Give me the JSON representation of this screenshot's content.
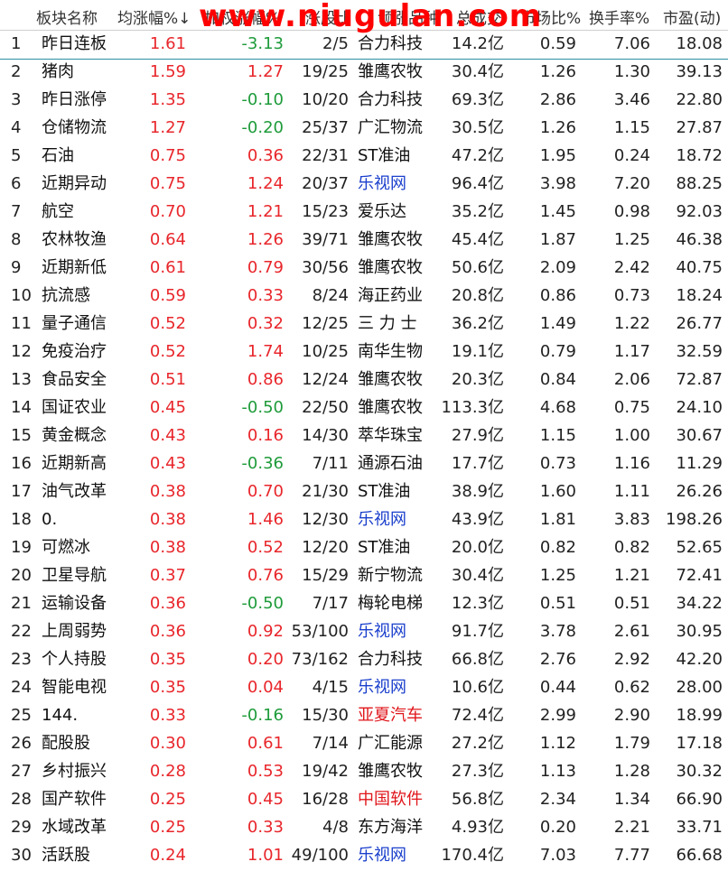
{
  "header": {
    "col_no": "",
    "col_name": "板块名称",
    "col_avg": "均涨幅%",
    "sort_indicator": "↓",
    "col_weighted": "加权涨幅%",
    "col_updown": "涨股比",
    "col_leader": "领涨品种",
    "col_amount": "总成交",
    "col_market": "市场比%",
    "col_turnover": "换手率%",
    "col_pe": "市盈(动)",
    "watermark": "www.niugulan.com"
  },
  "colors": {
    "up": "#e8262b",
    "down": "#1e9b3a",
    "link": "#1a3fcc"
  },
  "rows": [
    {
      "no": "1",
      "name": "昨日连板",
      "avg": "1.61",
      "wt": "-3.13",
      "ud": "2/5",
      "lead": "合力科技",
      "amt": "14.2亿",
      "mkt": "0.59",
      "turn": "7.06",
      "pe": "18.08",
      "lead_style": "normal",
      "wt_dir": "down"
    },
    {
      "no": "2",
      "name": "猪肉",
      "avg": "1.59",
      "wt": "1.27",
      "ud": "19/25",
      "lead": "雏鹰农牧",
      "amt": "30.4亿",
      "mkt": "1.26",
      "turn": "1.30",
      "pe": "39.13",
      "lead_style": "normal",
      "wt_dir": "up"
    },
    {
      "no": "3",
      "name": "昨日涨停",
      "avg": "1.35",
      "wt": "-0.10",
      "ud": "10/20",
      "lead": "合力科技",
      "amt": "69.3亿",
      "mkt": "2.86",
      "turn": "3.46",
      "pe": "22.80",
      "lead_style": "normal",
      "wt_dir": "down"
    },
    {
      "no": "4",
      "name": "仓储物流",
      "avg": "1.27",
      "wt": "-0.20",
      "ud": "25/37",
      "lead": "广汇物流",
      "amt": "30.5亿",
      "mkt": "1.26",
      "turn": "1.15",
      "pe": "27.87",
      "lead_style": "normal",
      "wt_dir": "down"
    },
    {
      "no": "5",
      "name": "石油",
      "avg": "0.75",
      "wt": "0.36",
      "ud": "22/31",
      "lead": "ST准油",
      "amt": "47.2亿",
      "mkt": "1.95",
      "turn": "0.24",
      "pe": "18.72",
      "lead_style": "normal",
      "wt_dir": "up"
    },
    {
      "no": "6",
      "name": "近期异动",
      "avg": "0.75",
      "wt": "1.24",
      "ud": "20/37",
      "lead": "乐视网",
      "amt": "96.4亿",
      "mkt": "3.98",
      "turn": "7.20",
      "pe": "88.25",
      "lead_style": "blue",
      "wt_dir": "up"
    },
    {
      "no": "7",
      "name": "航空",
      "avg": "0.70",
      "wt": "1.21",
      "ud": "15/23",
      "lead": "爱乐达",
      "amt": "35.2亿",
      "mkt": "1.45",
      "turn": "0.98",
      "pe": "92.03",
      "lead_style": "normal",
      "wt_dir": "up"
    },
    {
      "no": "8",
      "name": "农林牧渔",
      "avg": "0.64",
      "wt": "1.26",
      "ud": "39/71",
      "lead": "雏鹰农牧",
      "amt": "45.4亿",
      "mkt": "1.87",
      "turn": "1.25",
      "pe": "46.38",
      "lead_style": "normal",
      "wt_dir": "up"
    },
    {
      "no": "9",
      "name": "近期新低",
      "avg": "0.61",
      "wt": "0.79",
      "ud": "30/56",
      "lead": "雏鹰农牧",
      "amt": "50.6亿",
      "mkt": "2.09",
      "turn": "2.42",
      "pe": "40.75",
      "lead_style": "normal",
      "wt_dir": "up"
    },
    {
      "no": "10",
      "name": "抗流感",
      "avg": "0.59",
      "wt": "0.33",
      "ud": "8/24",
      "lead": "海正药业",
      "amt": "20.8亿",
      "mkt": "0.86",
      "turn": "0.73",
      "pe": "18.24",
      "lead_style": "normal",
      "wt_dir": "up"
    },
    {
      "no": "11",
      "name": "量子通信",
      "avg": "0.52",
      "wt": "0.32",
      "ud": "12/25",
      "lead": "三 力 士",
      "amt": "36.2亿",
      "mkt": "1.49",
      "turn": "1.22",
      "pe": "26.77",
      "lead_style": "normal",
      "wt_dir": "up"
    },
    {
      "no": "12",
      "name": "免疫治疗",
      "avg": "0.52",
      "wt": "1.74",
      "ud": "10/25",
      "lead": "南华生物",
      "amt": "19.1亿",
      "mkt": "0.79",
      "turn": "1.17",
      "pe": "32.59",
      "lead_style": "normal",
      "wt_dir": "up"
    },
    {
      "no": "13",
      "name": "食品安全",
      "avg": "0.51",
      "wt": "0.86",
      "ud": "12/24",
      "lead": "雏鹰农牧",
      "amt": "20.3亿",
      "mkt": "0.84",
      "turn": "2.06",
      "pe": "72.87",
      "lead_style": "normal",
      "wt_dir": "up"
    },
    {
      "no": "14",
      "name": "国证农业",
      "avg": "0.45",
      "wt": "-0.50",
      "ud": "22/50",
      "lead": "雏鹰农牧",
      "amt": "113.3亿",
      "mkt": "4.68",
      "turn": "0.75",
      "pe": "24.10",
      "lead_style": "normal",
      "wt_dir": "down"
    },
    {
      "no": "15",
      "name": "黄金概念",
      "avg": "0.43",
      "wt": "0.16",
      "ud": "14/30",
      "lead": "萃华珠宝",
      "amt": "27.9亿",
      "mkt": "1.15",
      "turn": "1.00",
      "pe": "30.67",
      "lead_style": "normal",
      "wt_dir": "up"
    },
    {
      "no": "16",
      "name": "近期新高",
      "avg": "0.43",
      "wt": "-0.36",
      "ud": "7/11",
      "lead": "通源石油",
      "amt": "17.7亿",
      "mkt": "0.73",
      "turn": "1.16",
      "pe": "11.29",
      "lead_style": "normal",
      "wt_dir": "down"
    },
    {
      "no": "17",
      "name": "油气改革",
      "avg": "0.38",
      "wt": "0.70",
      "ud": "21/30",
      "lead": "ST准油",
      "amt": "38.9亿",
      "mkt": "1.60",
      "turn": "1.11",
      "pe": "26.26",
      "lead_style": "normal",
      "wt_dir": "up"
    },
    {
      "no": "18",
      "name": "0.",
      "avg": "0.38",
      "wt": "1.46",
      "ud": "12/30",
      "lead": "乐视网",
      "amt": "43.9亿",
      "mkt": "1.81",
      "turn": "3.83",
      "pe": "198.26",
      "lead_style": "blue",
      "wt_dir": "up"
    },
    {
      "no": "19",
      "name": "可燃冰",
      "avg": "0.38",
      "wt": "0.52",
      "ud": "12/20",
      "lead": "ST准油",
      "amt": "20.0亿",
      "mkt": "0.82",
      "turn": "0.82",
      "pe": "52.65",
      "lead_style": "normal",
      "wt_dir": "up"
    },
    {
      "no": "20",
      "name": "卫星导航",
      "avg": "0.37",
      "wt": "0.76",
      "ud": "15/29",
      "lead": "新宁物流",
      "amt": "30.4亿",
      "mkt": "1.25",
      "turn": "1.21",
      "pe": "72.41",
      "lead_style": "normal",
      "wt_dir": "up"
    },
    {
      "no": "21",
      "name": "运输设备",
      "avg": "0.36",
      "wt": "-0.50",
      "ud": "7/17",
      "lead": "梅轮电梯",
      "amt": "12.3亿",
      "mkt": "0.51",
      "turn": "0.51",
      "pe": "34.22",
      "lead_style": "normal",
      "wt_dir": "down"
    },
    {
      "no": "22",
      "name": "上周弱势",
      "avg": "0.36",
      "wt": "0.92",
      "ud": "53/100",
      "lead": "乐视网",
      "amt": "91.7亿",
      "mkt": "3.78",
      "turn": "2.61",
      "pe": "30.95",
      "lead_style": "blue",
      "wt_dir": "up"
    },
    {
      "no": "23",
      "name": "个人持股",
      "avg": "0.35",
      "wt": "0.20",
      "ud": "73/162",
      "lead": "合力科技",
      "amt": "66.8亿",
      "mkt": "2.76",
      "turn": "2.92",
      "pe": "42.20",
      "lead_style": "normal",
      "wt_dir": "up"
    },
    {
      "no": "24",
      "name": "智能电视",
      "avg": "0.35",
      "wt": "0.04",
      "ud": "4/15",
      "lead": "乐视网",
      "amt": "10.6亿",
      "mkt": "0.44",
      "turn": "0.62",
      "pe": "28.00",
      "lead_style": "blue",
      "wt_dir": "up"
    },
    {
      "no": "25",
      "name": "144.",
      "avg": "0.33",
      "wt": "-0.16",
      "ud": "15/30",
      "lead": "亚夏汽车",
      "amt": "72.4亿",
      "mkt": "2.99",
      "turn": "2.90",
      "pe": "18.99",
      "lead_style": "red",
      "wt_dir": "down"
    },
    {
      "no": "26",
      "name": "配股股",
      "avg": "0.30",
      "wt": "0.61",
      "ud": "7/14",
      "lead": "广汇能源",
      "amt": "27.2亿",
      "mkt": "1.12",
      "turn": "1.79",
      "pe": "17.18",
      "lead_style": "normal",
      "wt_dir": "up"
    },
    {
      "no": "27",
      "name": "乡村振兴",
      "avg": "0.28",
      "wt": "0.53",
      "ud": "19/42",
      "lead": "雏鹰农牧",
      "amt": "27.3亿",
      "mkt": "1.13",
      "turn": "1.28",
      "pe": "30.32",
      "lead_style": "normal",
      "wt_dir": "up"
    },
    {
      "no": "28",
      "name": "国产软件",
      "avg": "0.25",
      "wt": "0.45",
      "ud": "16/28",
      "lead": "中国软件",
      "amt": "56.8亿",
      "mkt": "2.34",
      "turn": "1.34",
      "pe": "66.90",
      "lead_style": "red",
      "wt_dir": "up"
    },
    {
      "no": "29",
      "name": "水域改革",
      "avg": "0.25",
      "wt": "0.33",
      "ud": "4/8",
      "lead": "东方海洋",
      "amt": "4.93亿",
      "mkt": "0.20",
      "turn": "2.21",
      "pe": "33.71",
      "lead_style": "normal",
      "wt_dir": "up"
    },
    {
      "no": "30",
      "name": "活跃股",
      "avg": "0.24",
      "wt": "1.01",
      "ud": "49/100",
      "lead": "乐视网",
      "amt": "170.4亿",
      "mkt": "7.03",
      "turn": "7.77",
      "pe": "66.68",
      "lead_style": "blue",
      "wt_dir": "up"
    }
  ]
}
